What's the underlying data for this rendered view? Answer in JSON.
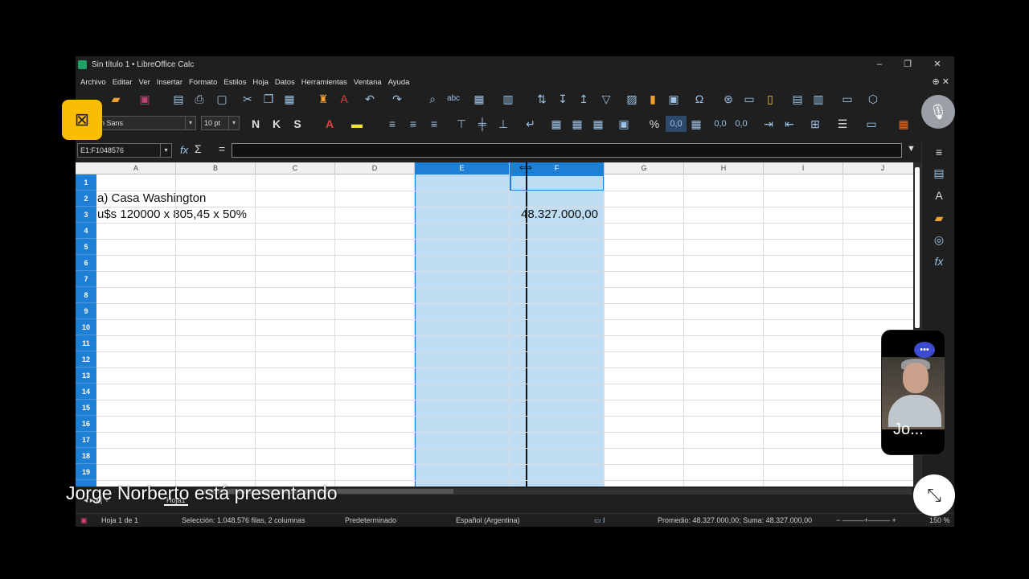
{
  "window": {
    "title": "Sin título 1 • LibreOffice Calc",
    "minimize": "–",
    "maximize": "❐",
    "close": "✕"
  },
  "menu": [
    "Archivo",
    "Editar",
    "Ver",
    "Insertar",
    "Formato",
    "Estilos",
    "Hoja",
    "Datos",
    "Herramientas",
    "Ventana",
    "Ayuda"
  ],
  "toolbar": {
    "font_name": "ion Sans",
    "font_size": "10 pt",
    "bold": "N",
    "italic": "K",
    "shadow": "S"
  },
  "formula_bar": {
    "name_box": "E1:F1048576",
    "fx": "fx",
    "sum": "Σ",
    "equals": "="
  },
  "columns": [
    "A",
    "B",
    "C",
    "D",
    "E",
    "F",
    "G",
    "H",
    "I",
    "J"
  ],
  "rows": [
    "1",
    "2",
    "3",
    "4",
    "5",
    "6",
    "7",
    "8",
    "9",
    "10",
    "11",
    "12",
    "13",
    "14",
    "15",
    "16",
    "17",
    "18",
    "19"
  ],
  "cells": {
    "a2": "a) Casa Washington",
    "a3": "u$s 120000 x 805,45 x 50%",
    "f3": "48.327.000,00"
  },
  "sheet_tab": "Hoja1",
  "status": {
    "sheet": "Hoja 1 de 1",
    "selection": "Selección: 1.048.576 filas, 2 columnas",
    "style": "Predeterminado",
    "language": "Español (Argentina)",
    "summary": "Promedio: 48.327.000,00; Suma: 48.327.000,00",
    "zoom": "150 %"
  },
  "meet": {
    "presenting": "Jorge Norberto está presentando",
    "participant": "Jo..."
  },
  "colors": {
    "selection": "#bedcf2",
    "accent": "#1e7fd6",
    "yellow": "#fbbc04"
  }
}
